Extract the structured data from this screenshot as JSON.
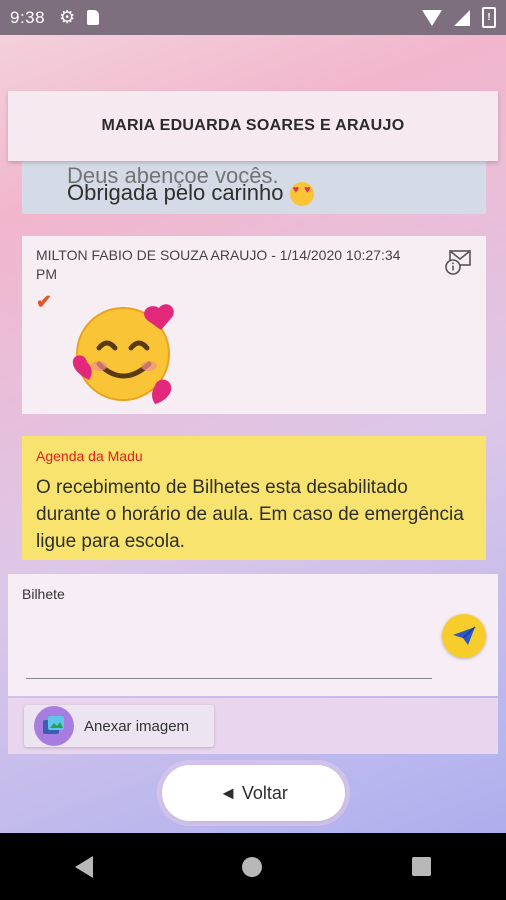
{
  "status_bar": {
    "time": "9:38",
    "battery_glyph": "!"
  },
  "header": {
    "title": "MARIA EDUARDA SOARES E ARAUJO"
  },
  "messages": {
    "outgoing": {
      "line1": "Deus abençoe vocês.",
      "line2": "Obrigada pelo carinho"
    },
    "incoming": {
      "sender": "MILTON FABIO DE SOUZA ARAUJO - 1/14/2020 10:27:34 PM",
      "check": "✔",
      "emoji": "smiling-face-with-hearts"
    }
  },
  "notice": {
    "title": "Agenda da Madu",
    "body": "O recebimento de Bilhetes esta desabilitado durante o horário de aula. Em caso de emergência ligue para escola."
  },
  "compose": {
    "label": "Bilhete",
    "value": "",
    "placeholder": ""
  },
  "attach": {
    "label": "Anexar imagem"
  },
  "back": {
    "label": "◄ Voltar"
  },
  "colors": {
    "notice_bg": "#f7e36e",
    "notice_title": "#e21f1f",
    "send_button": "#f7cd2b",
    "check": "#e2562c"
  }
}
